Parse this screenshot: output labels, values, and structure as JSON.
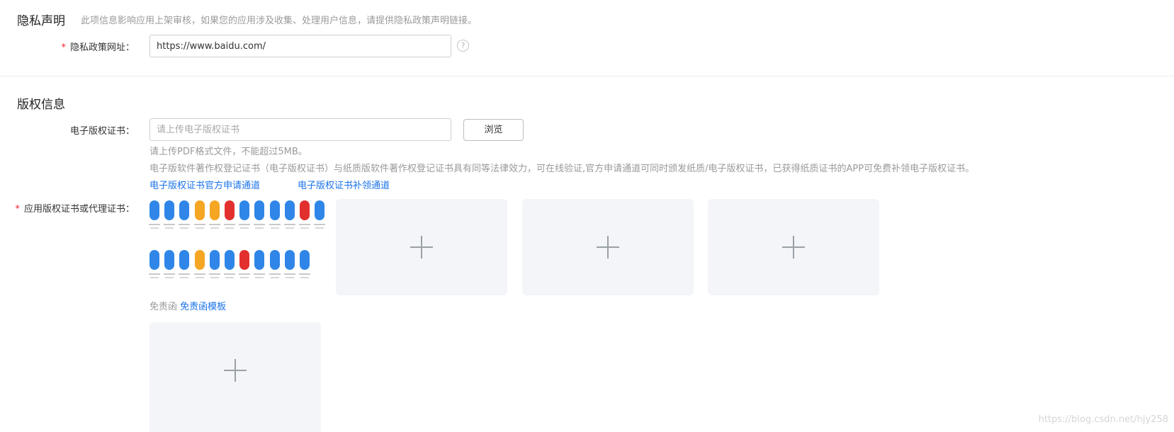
{
  "privacy": {
    "title": "隐私声明",
    "description": "此项信息影响应用上架审核，如果您的应用涉及收集、处理用户信息，请提供隐私政策声明链接。",
    "url_label": "隐私政策网址：",
    "url_value": "https://www.baidu.com/",
    "help_glyph": "?"
  },
  "copyright": {
    "title": "版权信息",
    "cert_label": "电子版权证书：",
    "cert_placeholder": "请上传电子版权证书",
    "browse_label": "浏览",
    "hint_format": "请上传PDF格式文件，不能超过5MB。",
    "hint_desc": "电子版软件著作权登记证书（电子版权证书）与纸质版软件著作权登记证书具有同等法律效力，可在线验证,官方申请通道可同时颁发纸质/电子版权证书，已获得纸质证书的APP可免费补领电子版权证书。",
    "link_apply": "电子版权证书官方申请通道",
    "link_reissue": "电子版权证书补领通道",
    "app_cert_label": "应用版权证书或代理证书：",
    "disclaimer_label": "免责函",
    "disclaimer_template_link": "免责函模板"
  },
  "colors": {
    "icon_blue": "#2f86e8",
    "icon_orange": "#f5a623",
    "icon_red": "#e2302e",
    "link": "#1a73e8"
  },
  "icons": [
    "question-circle-icon",
    "plus-icon",
    "app-icon-thumbnails"
  ],
  "watermark": "https://blog.csdn.net/hjy258"
}
